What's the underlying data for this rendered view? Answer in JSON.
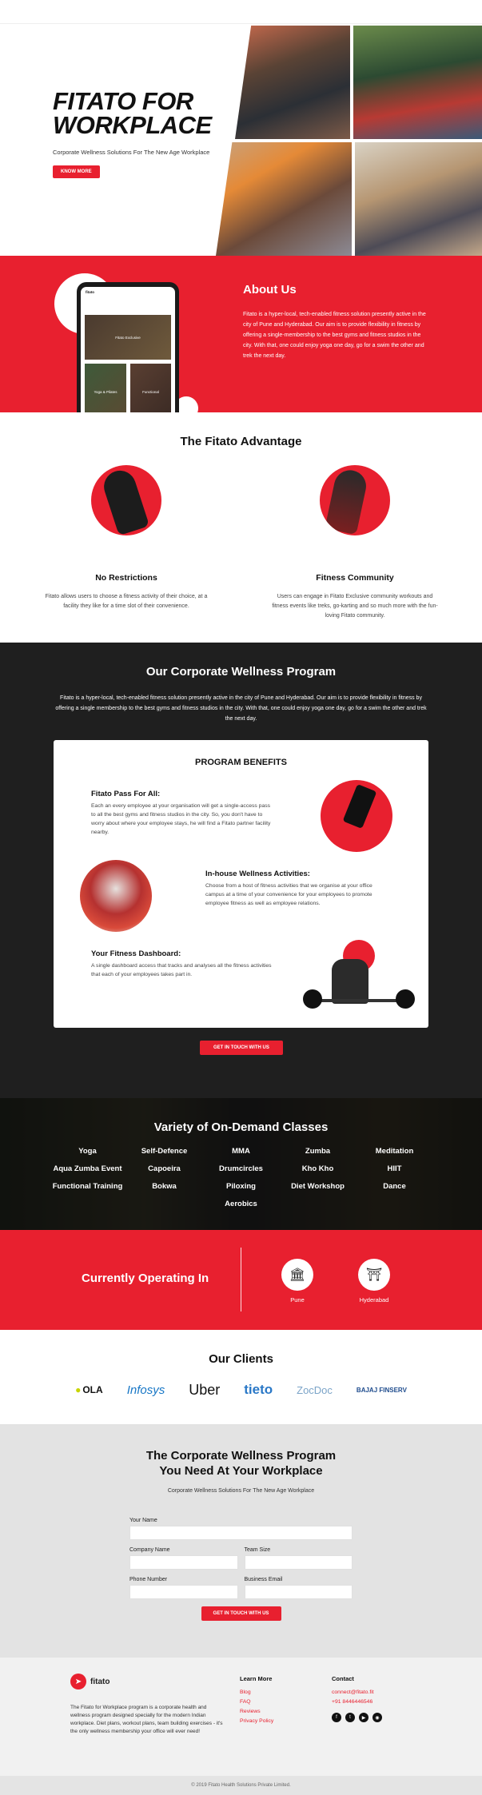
{
  "hero": {
    "title": "FITATO FOR\nWORKPLACE",
    "subtitle": "Corporate Wellness Solutions For The New Age Workplace",
    "cta": "KNOW MORE"
  },
  "about": {
    "title": "About Us",
    "text": "Fitato is a hyper-local, tech-enabled fitness solution presently active in the city of Pune and Hyderabad. Our aim is to provide flexibility in fitness by offering a single-membership to the best gyms and fitness studios in the city. With that, one could enjoy yoga one day, go for a swim the other and trek the next day."
  },
  "advantage": {
    "title": "The Fitato Advantage",
    "items": [
      {
        "title": "No Restrictions",
        "desc": "Fitato allows users to choose a fitness activity of their choice, at a facility they like for a time slot of their convenience."
      },
      {
        "title": "Fitness Community",
        "desc": "Users can engage in Fitato Exclusive community workouts and fitness events like treks, go-karting and so much more with the fun-loving Fitato community."
      }
    ]
  },
  "program": {
    "title": "Our Corporate Wellness Program",
    "intro": "Fitato is a hyper-local, tech-enabled fitness solution presently active in the city of Pune and Hyderabad. Our aim is to provide flexibility in fitness by offering a single membership to the best gyms and fitness studios in the city. With that, one could enjoy yoga one day, go for a swim the other and trek the next day.",
    "benefits_title": "PROGRAM BENEFITS",
    "benefits": [
      {
        "title": "Fitato Pass For All:",
        "desc": "Each an every employee at your organisation will get a single-access pass to all the best gyms and fitness studios in the city. So, you don't have to worry about where your employee stays, he will find a Fitato partner facility nearby."
      },
      {
        "title": "In-house Wellness Activities:",
        "desc": "Choose from a host of fitness activities that we organise at your office campus at a time of your convenience for your employees to promote employee fitness as well as employee relations."
      },
      {
        "title": "Your Fitness Dashboard:",
        "desc": "A single dashboard access that tracks and analyses all the fitness activities that each of your employees takes part in."
      }
    ],
    "cta": "GET IN TOUCH WITH US"
  },
  "classes": {
    "title": "Variety of On-Demand Classes",
    "items": [
      "Yoga",
      "Self-Defence",
      "MMA",
      "Zumba",
      "Meditation",
      "Aqua Zumba Event",
      "Capoeira",
      "Drumcircles",
      "Kho Kho",
      "HIIT",
      "Functional Training",
      "Bokwa",
      "Piloxing",
      "Diet Workshop",
      "Dance",
      "",
      "",
      "Aerobics",
      "",
      ""
    ]
  },
  "operating": {
    "title": "Currently Operating In",
    "cities": [
      "Pune",
      "Hyderabad"
    ]
  },
  "clients": {
    "title": "Our Clients",
    "logos": [
      "OLA",
      "Infosys",
      "Uber",
      "tieto",
      "ZocDoc",
      "BAJAJ FINSERV"
    ]
  },
  "form": {
    "title": "The Corporate Wellness Program\nYou Need At Your Workplace",
    "subtitle": "Corporate Wellness Solutions For The New Age Workplace",
    "labels": {
      "name": "Your Name",
      "company": "Company Name",
      "team": "Team Size",
      "phone": "Phone Number",
      "email": "Business Email"
    },
    "cta": "GET IN TOUCH WITH US"
  },
  "footer": {
    "brand": "fitato",
    "desc": "The Fitato for Workplace program is a corporate health and wellness program designed specially for the modern Indian workplace. Diet plans, workout plans, team building exercises - it's the only wellness membership your office will ever need!",
    "learn_title": "Learn More",
    "learn_links": [
      "Blog",
      "FAQ",
      "Reviews",
      "Privacy Policy"
    ],
    "contact_title": "Contact",
    "email": "connect@fitato.fit",
    "phone": "+91 8446446546",
    "copyright": "© 2019 Fitato Health Solutions Private Limited."
  },
  "colors": {
    "accent": "#e8202f",
    "dark": "#1f1f1f"
  }
}
